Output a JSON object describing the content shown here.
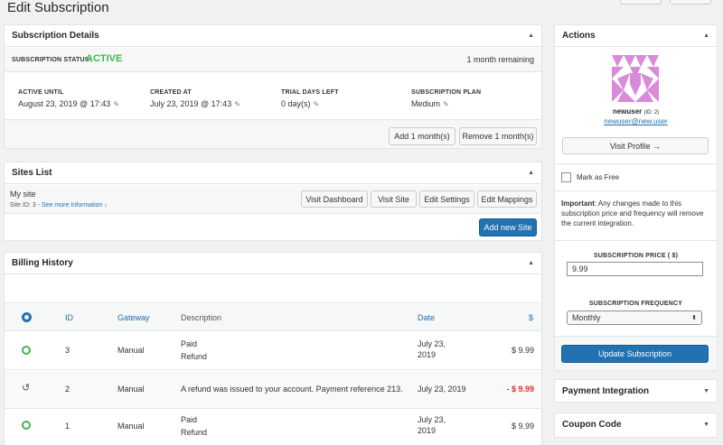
{
  "page": {
    "title": "Edit Subscription"
  },
  "subscription_details": {
    "title": "Subscription Details",
    "status_label": "SUBSCRIPTION STATUS:",
    "status_value": "ACTIVE",
    "remaining": "1 month remaining",
    "active_until_label": "ACTIVE UNTIL",
    "active_until_value": "August 23, 2019 @ 17:43",
    "created_at_label": "CREATED AT",
    "created_at_value": "July 23, 2019 @ 17:43",
    "trial_days_label": "TRIAL DAYS LEFT",
    "trial_days_value": "0 day(s)",
    "plan_label": "SUBSCRIPTION PLAN",
    "plan_value": "Medium",
    "add_month_button": "Add 1 month(s)",
    "remove_month_button": "Remove 1 month(s)"
  },
  "sites_list": {
    "title": "Sites List",
    "site_name": "My site",
    "site_id_text": "Site ID: 3 - ",
    "see_more": "See more Information ↓",
    "visit_dashboard": "Visit Dashboard",
    "visit_site": "Visit Site",
    "edit_settings": "Edit Settings",
    "edit_mappings": "Edit Mappings",
    "add_new_site": "Add new Site"
  },
  "billing_history": {
    "title": "Billing History",
    "columns": {
      "id": "ID",
      "gateway": "Gateway",
      "description": "Description",
      "date": "Date",
      "amount": "$"
    },
    "rows": [
      {
        "id": "3",
        "gateway": "Manual",
        "desc1": "Paid",
        "desc2": "Refund",
        "date1": "July 23,",
        "date2": "2019",
        "amount": "$ 9.99"
      },
      {
        "id": "2",
        "gateway": "Manual",
        "desc1": "A refund was issued to your account. Payment reference 213.",
        "desc2": "",
        "date1": "July 23, 2019",
        "date2": "",
        "amount": "- $ 9.99"
      },
      {
        "id": "1",
        "gateway": "Manual",
        "desc1": "Paid",
        "desc2": "Refund",
        "date1": "July 23,",
        "date2": "2019",
        "amount": "$ 9.99"
      }
    ]
  },
  "actions": {
    "title": "Actions",
    "username": "newuser",
    "user_id": "(ID: 2)",
    "email": "newuser@new.user",
    "visit_profile": "Visit Profile →",
    "mark_as_free": "Mark as Free",
    "important_label": "Important",
    "important_text": ": Any changes made to this subscription price and frequency will remove the current integration.",
    "price_label": "SUBSCRIPTION PRICE ( $)",
    "price_value": "9.99",
    "frequency_label": "SUBSCRIPTION FREQUENCY",
    "frequency_value": "Monthly",
    "update_button": "Update Subscription"
  },
  "payment_integration": {
    "title": "Payment Integration"
  },
  "coupon_code": {
    "title": "Coupon Code"
  },
  "colors": {
    "active": "#46b450",
    "refund": "#dc3232",
    "primary": "#2271b1"
  }
}
